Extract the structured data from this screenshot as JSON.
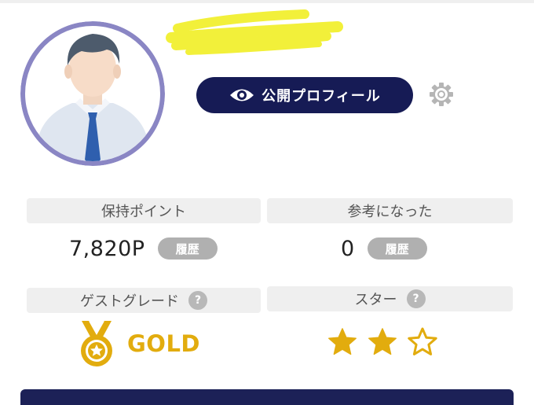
{
  "profile": {
    "avatar_icon": "person-avatar-icon",
    "name_redacted": true,
    "public_profile_label": "公開プロフィール",
    "public_profile_icon": "eye-icon",
    "settings_icon": "gear-icon"
  },
  "stats": {
    "points": {
      "label": "保持ポイント",
      "value": "7,820P",
      "history_label": "履歴"
    },
    "helpful": {
      "label": "参考になった",
      "value": "0",
      "history_label": "履歴"
    },
    "guest_grade": {
      "label": "ゲストグレード",
      "help": "?",
      "value": "GOLD",
      "icon": "gold-medal-icon"
    },
    "star": {
      "label": "スター",
      "help": "?",
      "filled": 2,
      "total": 3
    }
  },
  "colors": {
    "accent_navy": "#161b55",
    "gold": "#e2ac0e",
    "avatar_ring": "#8a86c4",
    "pill_gray": "#b0b0b0",
    "label_bg": "#efefef",
    "redaction_yellow": "#f2f03a"
  }
}
